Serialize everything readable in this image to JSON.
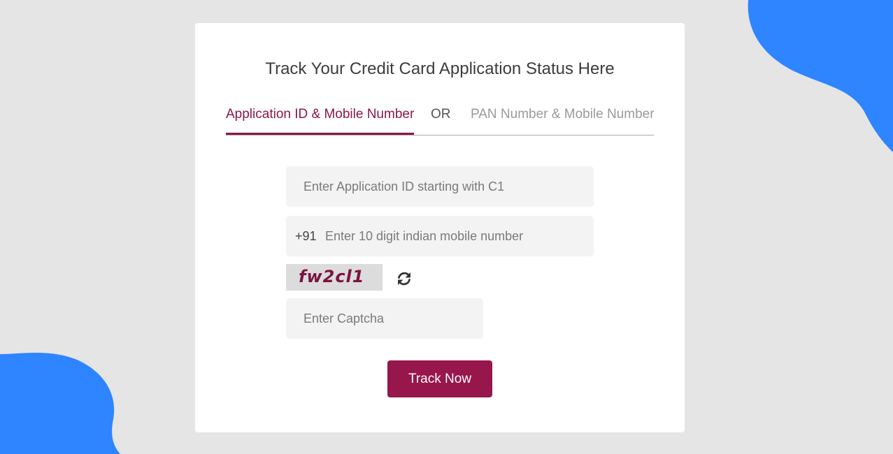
{
  "page": {
    "title": "Track Your Credit Card Application Status Here"
  },
  "tabs": {
    "active_label": "Application ID & Mobile Number",
    "separator": "OR",
    "inactive_label": "PAN Number & Mobile Number"
  },
  "form": {
    "application_id_placeholder": "Enter Application ID starting with C1",
    "mobile_prefix": "+91",
    "mobile_placeholder": "Enter 10 digit indian mobile number",
    "captcha_text": "fw2cl1",
    "captcha_placeholder": "Enter Captcha",
    "submit_label": "Track Now"
  },
  "icons": {
    "refresh": "refresh-icon"
  },
  "colors": {
    "accent": "#97164b",
    "active_tab": "#8b1749",
    "blob": "#2f84ff",
    "background": "#e5e5e5"
  }
}
